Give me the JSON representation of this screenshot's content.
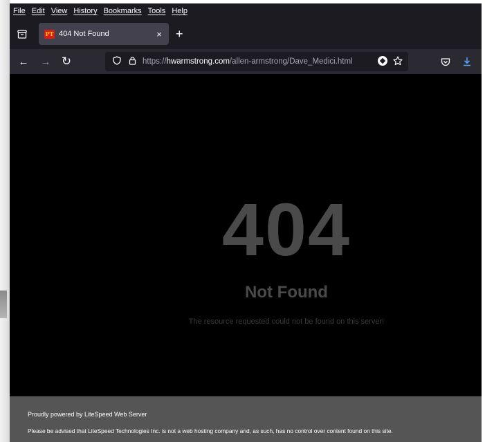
{
  "menu": [
    "File",
    "Edit",
    "View",
    "History",
    "Bookmarks",
    "Tools",
    "Help"
  ],
  "tab": {
    "favicon_text": "PT",
    "title": "404 Not Found",
    "close": "×"
  },
  "tabstrip": {
    "new_tab": "+"
  },
  "nav": {
    "back": "←",
    "forward": "→",
    "reload": "↻"
  },
  "url": {
    "scheme": "https://",
    "host": "hwarmstrong.com",
    "path": "/allen-armstrong/Dave_Medici.html"
  },
  "page": {
    "code": "404",
    "title": "Not Found",
    "description": "The resource requested could not be found on this server!"
  },
  "footer": {
    "powered": "Proudly powered by LiteSpeed Web Server",
    "notice": "Please be advised that LiteSpeed Technologies Inc. is not a web hosting company and, as such, has no control over content found on this site."
  },
  "icons": {
    "tab_overview": "tab-overview-icon",
    "shield": "shield-icon",
    "lock": "lock-icon",
    "reader": "reader-view-icon",
    "star": "star-icon",
    "pocket": "pocket-icon",
    "download": "download-icon"
  },
  "colors": {
    "download_accent": "#54a3ff",
    "footer_bg": "#555555",
    "error_text": "#4a4a4a"
  }
}
